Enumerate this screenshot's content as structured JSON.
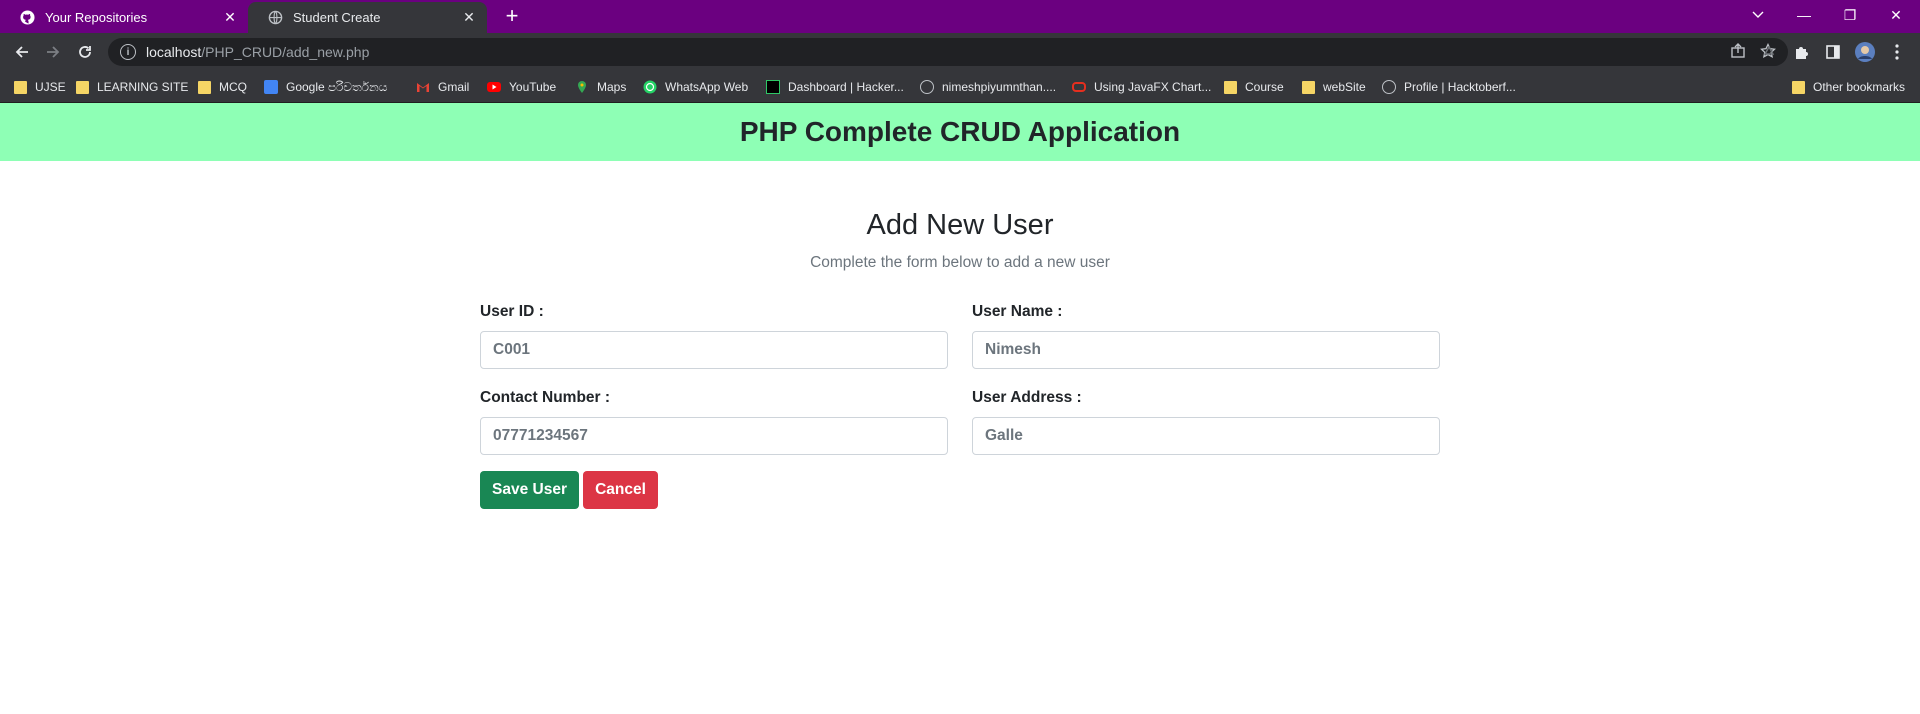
{
  "browser": {
    "tabs": [
      {
        "title": "Your Repositories",
        "active": false
      },
      {
        "title": "Student Create",
        "active": true
      }
    ],
    "new_tab": "+",
    "window_controls": {
      "minimize": "—",
      "restore": "❐",
      "close": "✕"
    },
    "address": {
      "host": "localhost",
      "path": "/PHP_CRUD/add_new.php"
    },
    "bookmarks": [
      {
        "label": "UJSE",
        "icon": "folder"
      },
      {
        "label": "LEARNING SITE",
        "icon": "folder"
      },
      {
        "label": "MCQ",
        "icon": "folder"
      },
      {
        "label": "Google පරිවර්තනය",
        "icon": "google-translate"
      },
      {
        "label": "Gmail",
        "icon": "gmail"
      },
      {
        "label": "YouTube",
        "icon": "youtube"
      },
      {
        "label": "Maps",
        "icon": "maps"
      },
      {
        "label": "WhatsApp Web",
        "icon": "whatsapp"
      },
      {
        "label": "Dashboard | Hacker...",
        "icon": "hackerrank"
      },
      {
        "label": "nimeshpiyumnthan....",
        "icon": "globe"
      },
      {
        "label": "Using JavaFX Chart...",
        "icon": "oracle"
      },
      {
        "label": "Course",
        "icon": "folder"
      },
      {
        "label": "webSite",
        "icon": "folder"
      },
      {
        "label": "Profile | Hacktoberf...",
        "icon": "hacktoberfest"
      }
    ],
    "other_bookmarks": "Other bookmarks"
  },
  "header": {
    "title": "PHP Complete CRUD Application"
  },
  "form": {
    "title": "Add New User",
    "subtitle": "Complete the form below to add a new user",
    "fields": {
      "user_id": {
        "label": "User ID :",
        "value": "C001"
      },
      "user_name": {
        "label": "User Name :",
        "value": "Nimesh"
      },
      "contact": {
        "label": "Contact Number :",
        "value": "07771234567"
      },
      "address": {
        "label": "User Address :",
        "value": "Galle"
      }
    },
    "save_label": "Save User",
    "cancel_label": "Cancel"
  },
  "colors": {
    "tab_strip": "#6b0080",
    "header_bg": "#8effb5",
    "save_btn": "#198754",
    "cancel_btn": "#dc3545"
  }
}
